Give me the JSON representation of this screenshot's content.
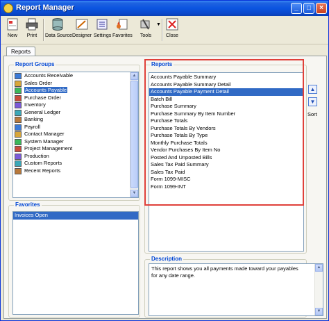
{
  "window": {
    "title": "Report Manager"
  },
  "toolbar": {
    "new": "New",
    "print": "Print",
    "data_source": "Data Source",
    "designer": "Designer",
    "settings": "Settings",
    "favorites": "Favorites",
    "tools": "Tools",
    "close": "Close"
  },
  "tabs": {
    "reports": "Reports"
  },
  "report_groups": {
    "label": "Report Groups",
    "items": [
      "Accounts Receivable",
      "Sales Order",
      "Accounts Payable",
      "Purchase Order",
      "Inventory",
      "General Ledger",
      "Banking",
      "Payroll",
      "Contact Manager",
      "System Manager",
      "Project Management",
      "Production",
      "Custom Reports",
      "Recent Reports"
    ],
    "selected_index": 2
  },
  "favorites": {
    "label": "Favorites",
    "items": [
      "Invoices Open"
    ]
  },
  "reports": {
    "label": "Reports",
    "items": [
      "Accounts Payable Summary",
      "Accounts Payable Summary Detail",
      "Accounts Payable Payment Detail",
      "Batch Bill",
      "Purchase Summary",
      "Purchase Summary By Item Number",
      "Purchase Totals",
      "Purchase Totals By Vendors",
      "Purchase Totals By Type",
      "Monthly Purchase Totals",
      "Vendor Purchases By Item No",
      "Posted And Unposted Bills",
      "Sales Tax Paid Summary",
      "Sales Tax Paid",
      "Form 1099-MISC",
      "Form 1099-INT"
    ],
    "selected_index": 2
  },
  "sort": {
    "label": "Sort"
  },
  "description": {
    "label": "Description",
    "text": "This report shows you all payments made toward your payables for any date range."
  }
}
